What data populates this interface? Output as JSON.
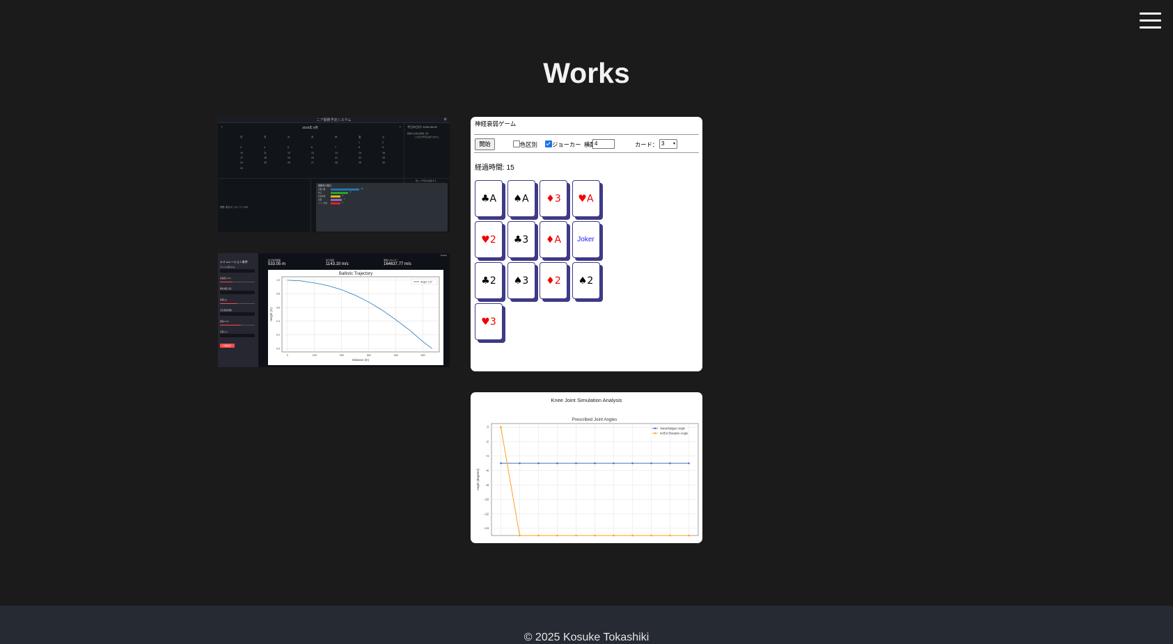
{
  "nav": {
    "menu_icon": "hamburger-icon"
  },
  "page": {
    "title": "Works"
  },
  "works": {
    "calendar": {
      "header": "ニア勤務予定システム",
      "month": "2025年 8月",
      "weekdays": [
        "日",
        "月",
        "火",
        "水",
        "木",
        "金",
        "土"
      ],
      "days": [
        [
          "",
          "",
          "",
          "",
          "",
          "1",
          "2"
        ],
        [
          "3",
          "4",
          "5",
          "6",
          "7",
          "8",
          "9"
        ],
        [
          "10",
          "11",
          "12",
          "13",
          "14",
          "15",
          "16"
        ],
        [
          "17",
          "18",
          "19",
          "20",
          "21",
          "22",
          "23"
        ],
        [
          "24",
          "25",
          "26",
          "27",
          "28",
          "29",
          "30"
        ],
        [
          "31",
          "",
          "",
          "",
          "",
          "",
          ""
        ]
      ],
      "side_title": "今日の日付: 2025-08-09",
      "side_line1": "勤務のお休み登録: 1件",
      "side_line2": "この日の予定はありません",
      "side_line3": "新しい予定を追加する",
      "bottom_note": "勤務: 集計なしのシフトのみ",
      "panel_title": "勤務月の集計",
      "panel_rows": [
        {
          "label": "出勤日数",
          "value": "14",
          "ratio": 0.9,
          "color": "#1f77b4"
        },
        {
          "label": "休日",
          "value": "8",
          "ratio": 0.55,
          "color": "#2ca02c"
        },
        {
          "label": "有給休暇",
          "value": "3",
          "ratio": 0.3,
          "color": "#e6b800"
        },
        {
          "label": "欠勤",
          "value": "1",
          "ratio": 0.35,
          "color": "#9467bd"
        },
        {
          "label": "シフト外勤",
          "value": "2",
          "ratio": 0.3,
          "color": "#d62728"
        }
      ]
    },
    "memory_game": {
      "title": "神経衰弱ゲーム",
      "start_label": "開始",
      "color_option_label": "色区別",
      "color_option_checked": false,
      "joker_label": "ジョーカー",
      "joker_checked": true,
      "layout_label": "横配置数:",
      "layout_value": "4",
      "cards_label": "カード：",
      "cards_value": "3",
      "elapsed": "経過時間: 15",
      "cards": [
        {
          "suit": "♣",
          "rank": "A",
          "color": "black"
        },
        {
          "suit": "♠",
          "rank": "A",
          "color": "black"
        },
        {
          "suit": "♦",
          "rank": "3",
          "color": "red"
        },
        {
          "suit": "♥",
          "rank": "A",
          "color": "red"
        },
        {
          "suit": "♥",
          "rank": "2",
          "color": "red"
        },
        {
          "suit": "♣",
          "rank": "3",
          "color": "black"
        },
        {
          "suit": "♦",
          "rank": "A",
          "color": "red"
        },
        {
          "suit": "",
          "rank": "Joker",
          "color": "blue"
        },
        {
          "suit": "♣",
          "rank": "2",
          "color": "black"
        },
        {
          "suit": "♠",
          "rank": "3",
          "color": "black"
        },
        {
          "suit": "♦",
          "rank": "2",
          "color": "red"
        },
        {
          "suit": "♠",
          "rank": "2",
          "color": "black"
        },
        {
          "suit": "♥",
          "rank": "3",
          "color": "red"
        }
      ]
    },
    "ballistic": {
      "sidebar_title": "シミュレーション条件",
      "sidebar_labels": [
        "ライフル弾 (mm)",
        "初速度 (m/s)",
        "発射角度 (度)",
        "質量 (g)",
        "空気抵抗係数",
        "風速 (m/s)",
        "高度 (m)"
      ],
      "run_button": "計算実行",
      "deploy": "Deploy",
      "metrics": [
        {
          "label": "最大到達距離",
          "value": "533.05 m"
        },
        {
          "label": "最大速度",
          "value": "1143.10 m/s"
        },
        {
          "label": "運動エネルギー",
          "value": "164637.77 m/s"
        }
      ],
      "chart_data": {
        "type": "line",
        "title": "Ballistic Trajectory",
        "xlabel": "Distance (m)",
        "ylabel": "Height (m)",
        "xlim": [
          -20,
          560
        ],
        "ylim": [
          -0.05,
          1.05
        ],
        "x_ticks": [
          0,
          100,
          200,
          300,
          400,
          500
        ],
        "y_ticks": [
          0.0,
          0.2,
          0.4,
          0.6,
          0.8,
          1.0
        ],
        "grid": true,
        "legend_position": "top-right",
        "series": [
          {
            "name": "Angle: 0.0°",
            "color": "#1f77b4",
            "x": [
              0,
              50,
              100,
              150,
              200,
              250,
              300,
              350,
              400,
              450,
              500,
              533
            ],
            "y": [
              1.0,
              0.99,
              0.96,
              0.92,
              0.86,
              0.78,
              0.68,
              0.56,
              0.42,
              0.27,
              0.1,
              0.0
            ]
          }
        ]
      }
    },
    "knee": {
      "title": "Knee Joint Simulation Analysis",
      "chart_data": {
        "type": "line",
        "title": "Prescribed Joint Angles",
        "xlabel": "",
        "ylabel": "Angle (degrees)",
        "xlim": [
          -0.5,
          10.5
        ],
        "ylim": [
          -15,
          0.5
        ],
        "y_ticks": [
          0,
          -2,
          -4,
          -6,
          -8,
          -10,
          -12,
          -14
        ],
        "grid": true,
        "legend_position": "top-right",
        "x": [
          0,
          1,
          2,
          3,
          4,
          5,
          6,
          7,
          8,
          9,
          10
        ],
        "series": [
          {
            "name": "Varus/Valgus Angle",
            "color": "#4472c4",
            "values": [
              -5,
              -5,
              -5,
              -5,
              -5,
              -5,
              -5,
              -5,
              -5,
              -5,
              -5
            ]
          },
          {
            "name": "Int/Ext Rotation Angle",
            "color": "#ff9f1c",
            "values": [
              0,
              -15,
              -15,
              -15,
              -15,
              -15,
              -15,
              -15,
              -15,
              -15,
              -15
            ]
          }
        ]
      }
    }
  },
  "footer": {
    "copyright": "© 2025 Kosuke Tokashiki"
  }
}
